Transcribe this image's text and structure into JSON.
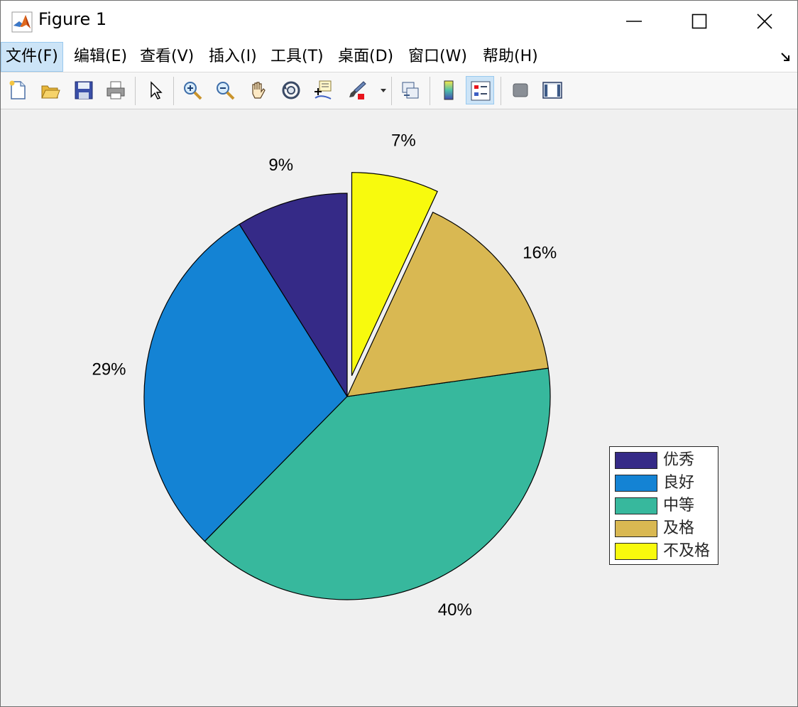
{
  "window": {
    "title": "Figure 1"
  },
  "menu": [
    {
      "label": "文件(F)",
      "active": true
    },
    {
      "label": "编辑(E)",
      "active": false
    },
    {
      "label": "查看(V)",
      "active": false
    },
    {
      "label": "插入(I)",
      "active": false
    },
    {
      "label": "工具(T)",
      "active": false
    },
    {
      "label": "桌面(D)",
      "active": false
    },
    {
      "label": "窗口(W)",
      "active": false
    },
    {
      "label": "帮助(H)",
      "active": false
    }
  ],
  "toolbar": [
    {
      "icon": "new-figure-icon"
    },
    {
      "icon": "open-file-icon"
    },
    {
      "icon": "save-icon"
    },
    {
      "icon": "print-icon"
    },
    {
      "icon": "pointer-icon"
    },
    {
      "icon": "zoom-in-icon"
    },
    {
      "icon": "zoom-out-icon"
    },
    {
      "icon": "pan-icon"
    },
    {
      "icon": "rotate-3d-icon"
    },
    {
      "icon": "data-cursor-icon"
    },
    {
      "icon": "brush-icon"
    },
    {
      "icon": "link-plot-icon"
    },
    {
      "icon": "colorbar-icon"
    },
    {
      "icon": "legend-icon",
      "pressed": true
    },
    {
      "icon": "hide-plot-tools-icon"
    },
    {
      "icon": "show-plot-tools-icon"
    }
  ],
  "chart_data": {
    "type": "pie",
    "labels": [
      "优秀",
      "良好",
      "中等",
      "及格",
      "不及格"
    ],
    "percent_labels": [
      "9%",
      "29%",
      "40%",
      "16%",
      "7%"
    ],
    "values": [
      9,
      29,
      40,
      16,
      7
    ],
    "explode": [
      0,
      0,
      0,
      0,
      1
    ],
    "colors": [
      "#352a87",
      "#1483d4",
      "#37b89d",
      "#d9b852",
      "#f8fa0d"
    ],
    "start": "12 o'clock, counterclockwise",
    "legend": {
      "position": "right",
      "entries": [
        "优秀",
        "良好",
        "中等",
        "及格",
        "不及格"
      ]
    }
  }
}
